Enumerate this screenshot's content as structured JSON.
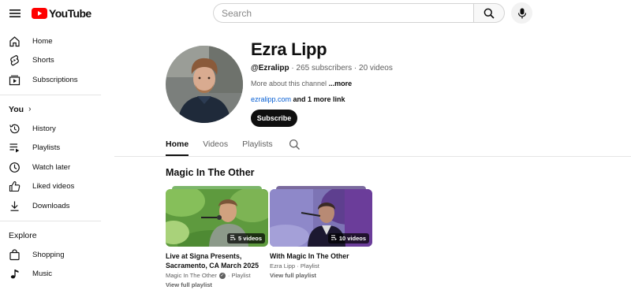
{
  "header": {
    "logo_text": "YouTube",
    "search_placeholder": "Search"
  },
  "sidebar": {
    "main": [
      {
        "label": "Home",
        "icon": "home-icon"
      },
      {
        "label": "Shorts",
        "icon": "shorts-icon"
      },
      {
        "label": "Subscriptions",
        "icon": "subscriptions-icon"
      }
    ],
    "you_heading": "You",
    "you": [
      {
        "label": "History",
        "icon": "history-icon"
      },
      {
        "label": "Playlists",
        "icon": "playlists-icon"
      },
      {
        "label": "Watch later",
        "icon": "watch-later-icon"
      },
      {
        "label": "Liked videos",
        "icon": "like-icon"
      },
      {
        "label": "Downloads",
        "icon": "download-icon"
      }
    ],
    "explore_heading": "Explore",
    "explore": [
      {
        "label": "Shopping",
        "icon": "shopping-icon"
      },
      {
        "label": "Music",
        "icon": "music-icon"
      }
    ]
  },
  "channel": {
    "name": "Ezra Lipp",
    "handle": "@Ezralipp",
    "stats": " · 265 subscribers · 20 videos",
    "description": "More about this channel ",
    "description_more": "...more",
    "link": "ezralipp.com",
    "link_more": " and 1 more link",
    "subscribe_label": "Subscribe"
  },
  "tabs": [
    {
      "label": "Home",
      "active": true
    },
    {
      "label": "Videos",
      "active": false
    },
    {
      "label": "Playlists",
      "active": false
    }
  ],
  "section": {
    "title": "Magic In The Other",
    "cards": [
      {
        "title_line1": "Live at Signa Presents,",
        "title_line2": "Sacramento, CA March 2025",
        "channel": "Magic In The Other",
        "type": "Playlist",
        "count": "5 videos",
        "view_label": "View full playlist",
        "verified": true
      },
      {
        "title_line1": "With Magic In The Other",
        "title_line2": "",
        "channel": "Ezra Lipp",
        "type": "Playlist",
        "count": "10 videos",
        "view_label": "View full playlist",
        "verified": false
      }
    ]
  },
  "colors": {
    "brand_red": "#ff0000",
    "link_blue": "#065fd4",
    "text_secondary": "#606060"
  }
}
